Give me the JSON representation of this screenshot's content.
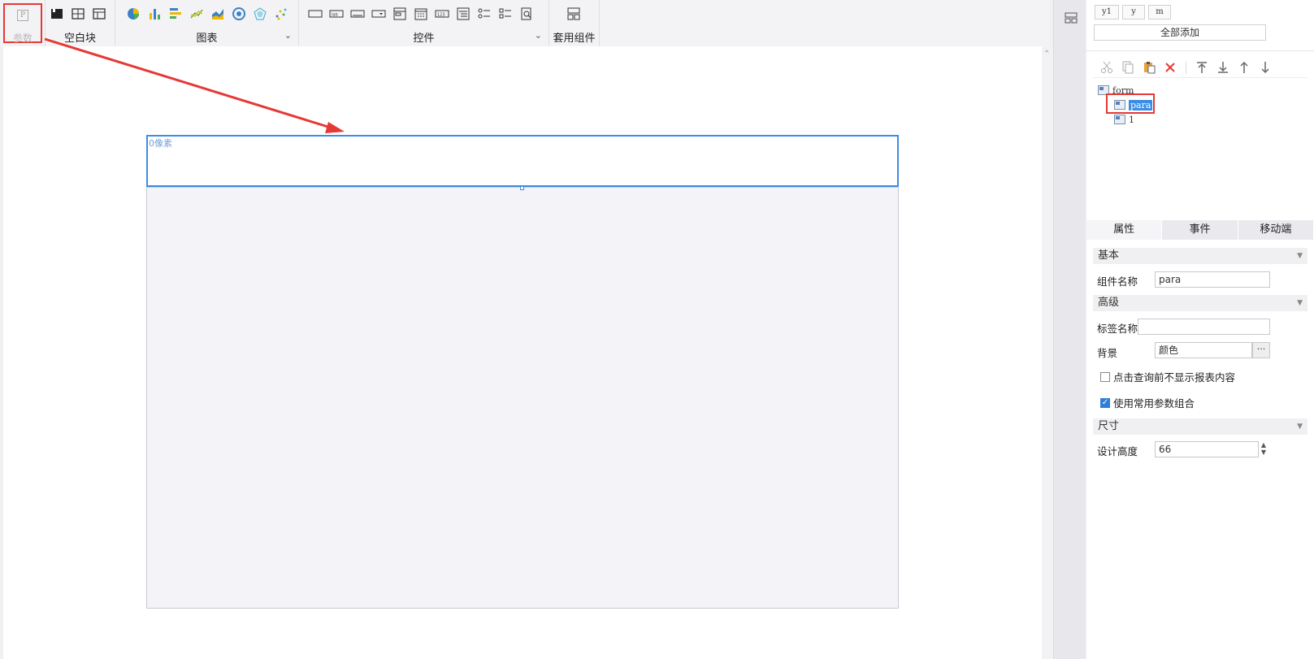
{
  "toolbar": {
    "param_label": "参数",
    "blank_label": "空白块",
    "chart_label": "图表",
    "control_label": "控件",
    "component_label": "套用组件",
    "chart_icons": [
      "pie-chart-icon",
      "bar-chart-icon",
      "horizontal-bar-icon",
      "line-chart-icon",
      "area-chart-icon",
      "gauge-chart-icon",
      "radar-chart-icon",
      "scatter-chart-icon"
    ],
    "control_icons": [
      "textbox-icon",
      "label-icon",
      "button-icon",
      "dropdown-icon",
      "combobox-icon",
      "date-icon",
      "number-icon",
      "tree-icon",
      "radio-group-icon",
      "checkbox-group-icon",
      "query-button-icon"
    ]
  },
  "canvas": {
    "para_size_label": "0像素"
  },
  "panel": {
    "chips": [
      "y1",
      "y",
      "m"
    ],
    "add_all_label": "全部添加",
    "tree": {
      "root": "form",
      "children": [
        "para",
        "1"
      ]
    },
    "tabs": [
      "属性",
      "事件",
      "移动端"
    ],
    "sections": {
      "basic": "基本",
      "advanced": "高级",
      "size": "尺寸"
    },
    "props": {
      "widget_name_label": "组件名称",
      "widget_name_value": "para",
      "tag_name_label": "标签名称",
      "tag_name_value": "",
      "background_label": "背景",
      "background_value": "颜色",
      "no_show_before_query": "点击查询前不显示报表内容",
      "use_common_params": "使用常用参数组合",
      "design_height_label": "设计高度",
      "design_height_value": "66"
    }
  },
  "colors": {
    "accent": "#3a8ee6",
    "highlight": "#e53935"
  }
}
